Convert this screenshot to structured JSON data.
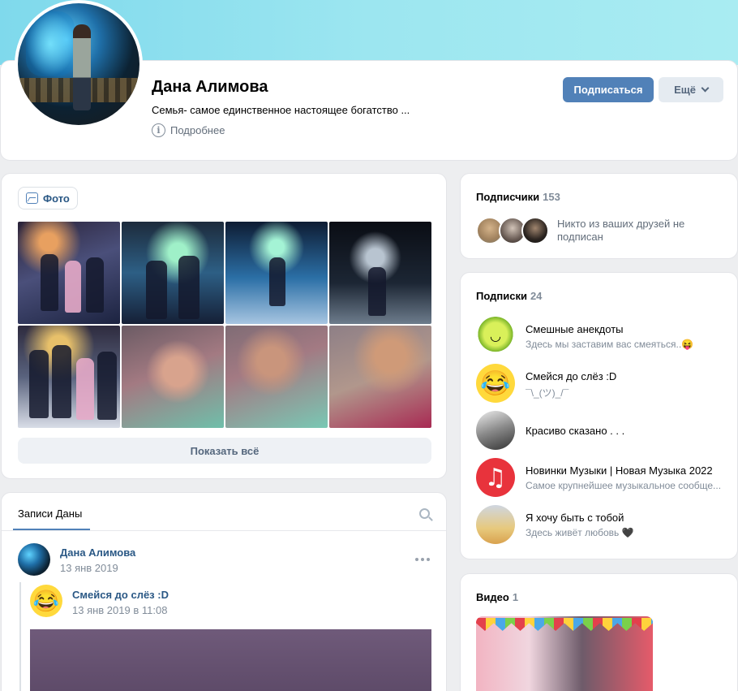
{
  "profile": {
    "name": "Дана Алимова",
    "status": "Семья- самое единственное настоящее богатство ...",
    "more_info": "Подробнее",
    "subscribe_label": "Подписаться",
    "more_label": "Ещё"
  },
  "photos": {
    "tab_label": "Фото",
    "show_all": "Показать всё"
  },
  "wall": {
    "tab_label": "Записи Даны",
    "post": {
      "author": "Дана Алимова",
      "date": "13 янв 2019",
      "repost": {
        "author": "Смейся до слёз :D",
        "date": "13 янв 2019 в 11:08"
      }
    }
  },
  "subscribers": {
    "title": "Подписчики",
    "count": "153",
    "note": "Никто из ваших друзей не подписан"
  },
  "subscriptions": {
    "title": "Подписки",
    "count": "24",
    "items": [
      {
        "name": "Смешные анекдоты",
        "desc": "Здесь мы заставим вас смеяться..😝",
        "icon": "apple-smiley-icon"
      },
      {
        "name": "Смейся до слёз :D",
        "desc": "¯\\_(ツ)_/¯",
        "icon": "laughing-emoji-icon"
      },
      {
        "name": "Красиво сказано . . .",
        "desc": "",
        "icon": "portrait-icon"
      },
      {
        "name": "Новинки Музыки | Новая Музыка 2022",
        "desc": "Самое крупнейшее музыкальное сообще...",
        "icon": "music-note-icon"
      },
      {
        "name": "Я хочу быть с тобой",
        "desc": "Здесь живёт любовь 🖤",
        "icon": "hands-icon"
      }
    ]
  },
  "video": {
    "title": "Видео",
    "count": "1"
  },
  "colors": {
    "accent": "#5181b8",
    "link": "#2a5885",
    "muted": "#818c99",
    "background": "#edeef0"
  }
}
